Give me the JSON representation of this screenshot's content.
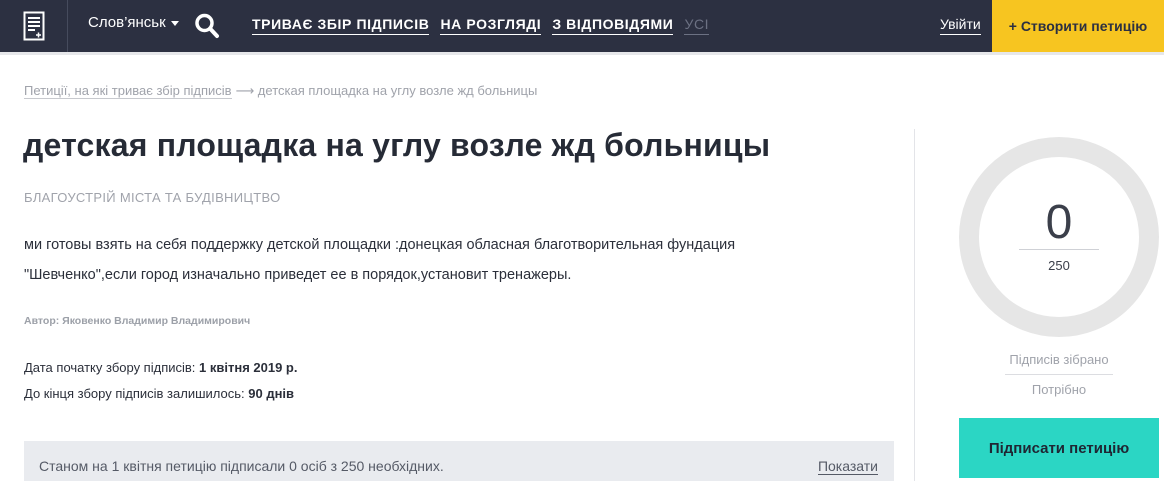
{
  "header": {
    "city": "Слов’янськ",
    "nav": [
      "ТРИВАЄ ЗБІР ПІДПИСІВ",
      "НА РОЗГЛЯДІ",
      "З ВІДПОВІДЯМИ",
      "УСІ"
    ],
    "login": "Увійти",
    "create_petition": "+ Створити петицію"
  },
  "breadcrumb": {
    "link": "Петиції, на які триває збір підписів",
    "current": "⟶ детская площадка на углу возле жд больницы"
  },
  "petition": {
    "title": "детская площадка на углу возле жд больницы",
    "category": "БЛАГОУСТРІЙ МІСТА ТА БУДІВНИЦТВО",
    "description_line1": "ми готовы взять на себя поддержку детской площадки :донецкая обласная благотворительная фундация",
    "description_line2": "\"Шевченко\",если город изначально приведет ее в порядок,установит тренажеры.",
    "author": "Автор: Яковенко Владимир Владимирович",
    "start_label": "Дата початку збору підписів: ",
    "start_value": "1 квітня 2019 р.",
    "remaining_label": "До кінця збору підписів залишилось: ",
    "remaining_value": "90 днів",
    "status_text": "Станом на 1 квітня петицію підписали 0 осіб з 250 необхідних.",
    "show_link": "Показати"
  },
  "sidebar": {
    "signatures": "0",
    "goal": "250",
    "collected_label": "Підписів зібрано",
    "needed_label": "Потрібно",
    "sign_button": "Підписати петицію"
  },
  "colors": {
    "header_bg": "#2c3041",
    "create_button": "#f7c520",
    "sign_button": "#2bd6c4",
    "ring": "#e6e6e6"
  },
  "icons": {
    "logo": "document-icon",
    "search": "search-icon",
    "dropdown": "caret-down-icon"
  }
}
